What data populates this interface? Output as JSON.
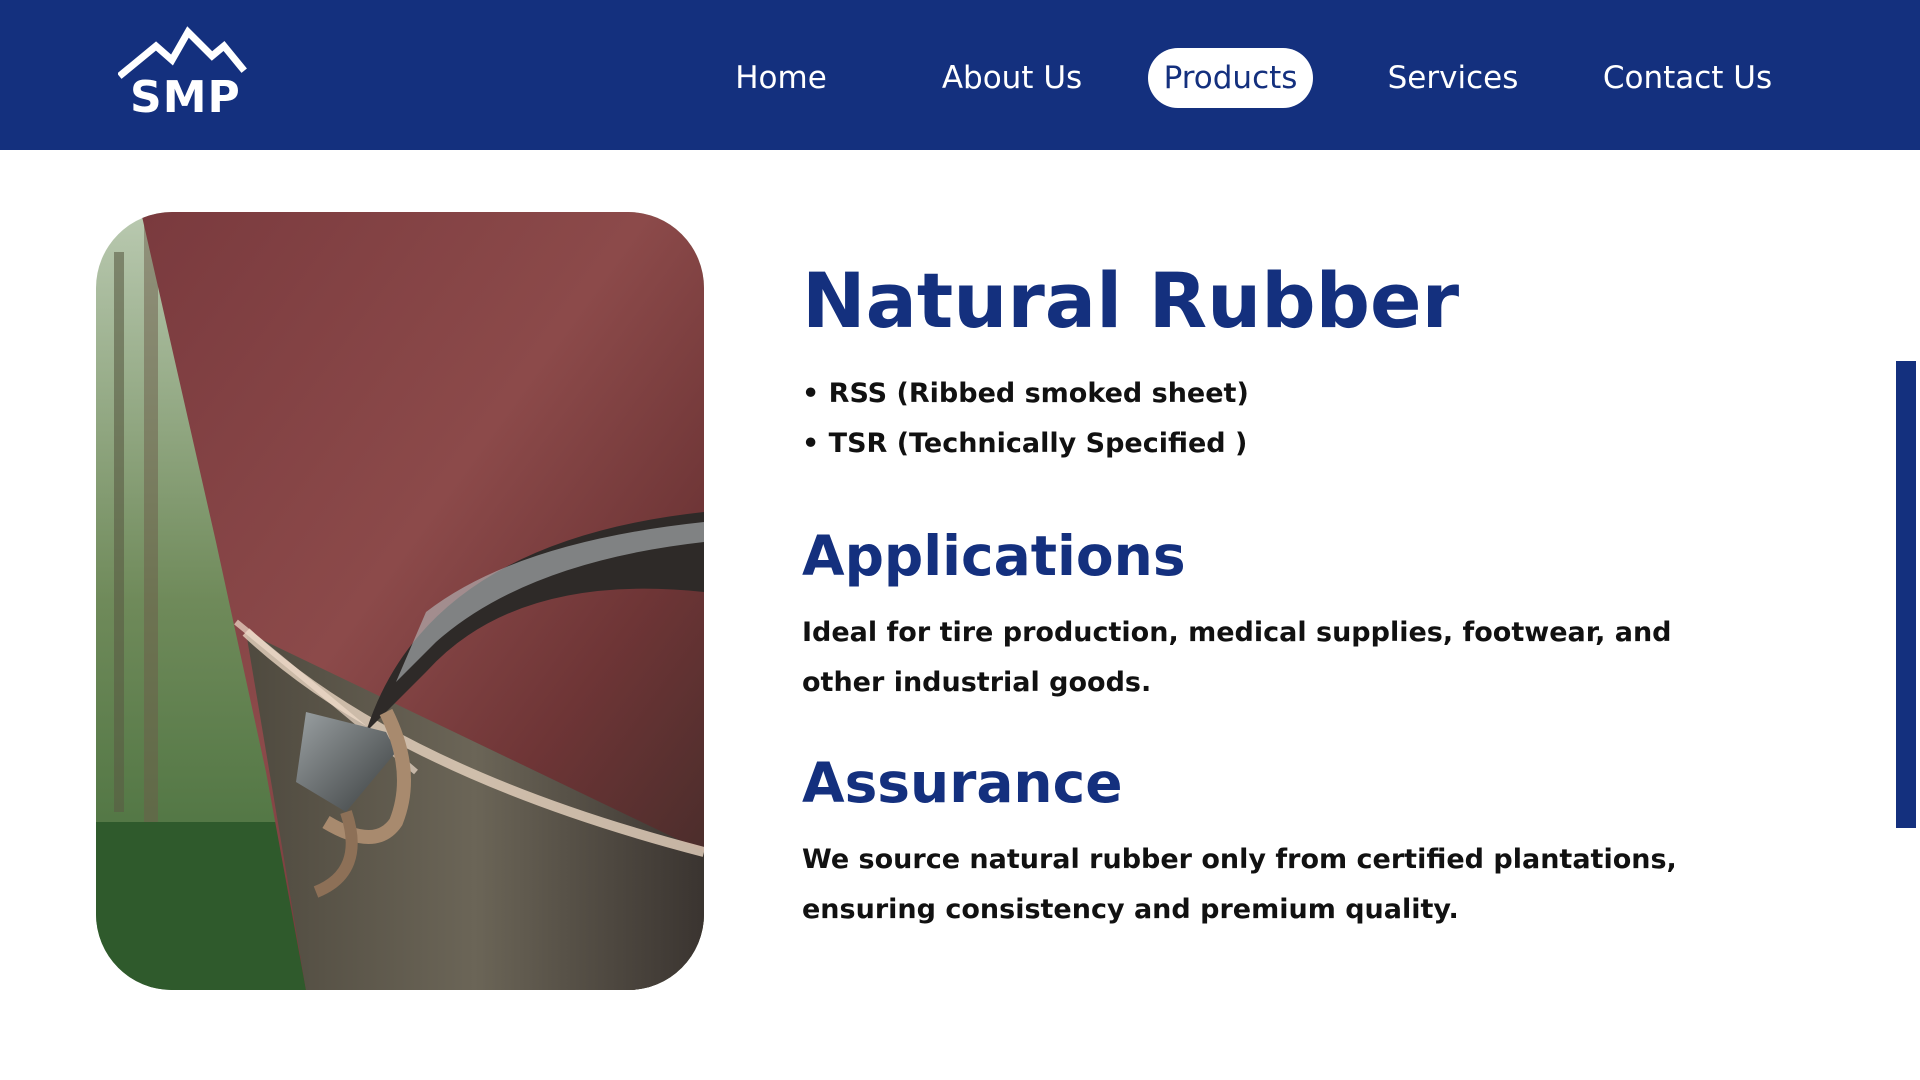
{
  "brand": {
    "logo_text": "SMP",
    "logo_icon": "mountain-icon"
  },
  "nav": {
    "items": [
      {
        "label": "Home",
        "active": false
      },
      {
        "label": "About Us",
        "active": false
      },
      {
        "label": "Products",
        "active": true
      },
      {
        "label": "Services",
        "active": false
      },
      {
        "label": "Contact Us",
        "active": false
      }
    ]
  },
  "product": {
    "title": "Natural Rubber",
    "bullets": [
      "• RSS (Ribbed smoked sheet)",
      "• TSR (Technically Specified )"
    ],
    "sections": [
      {
        "heading": "Applications",
        "text": "Ideal for tire production, medical supplies, footwear, and other industrial goods."
      },
      {
        "heading": "Assurance",
        "text": "We source natural rubber only from certified plantations, ensuring consistency and premium quality."
      }
    ]
  },
  "colors": {
    "primary": "#14307e",
    "text": "#111111",
    "background": "#ffffff"
  }
}
